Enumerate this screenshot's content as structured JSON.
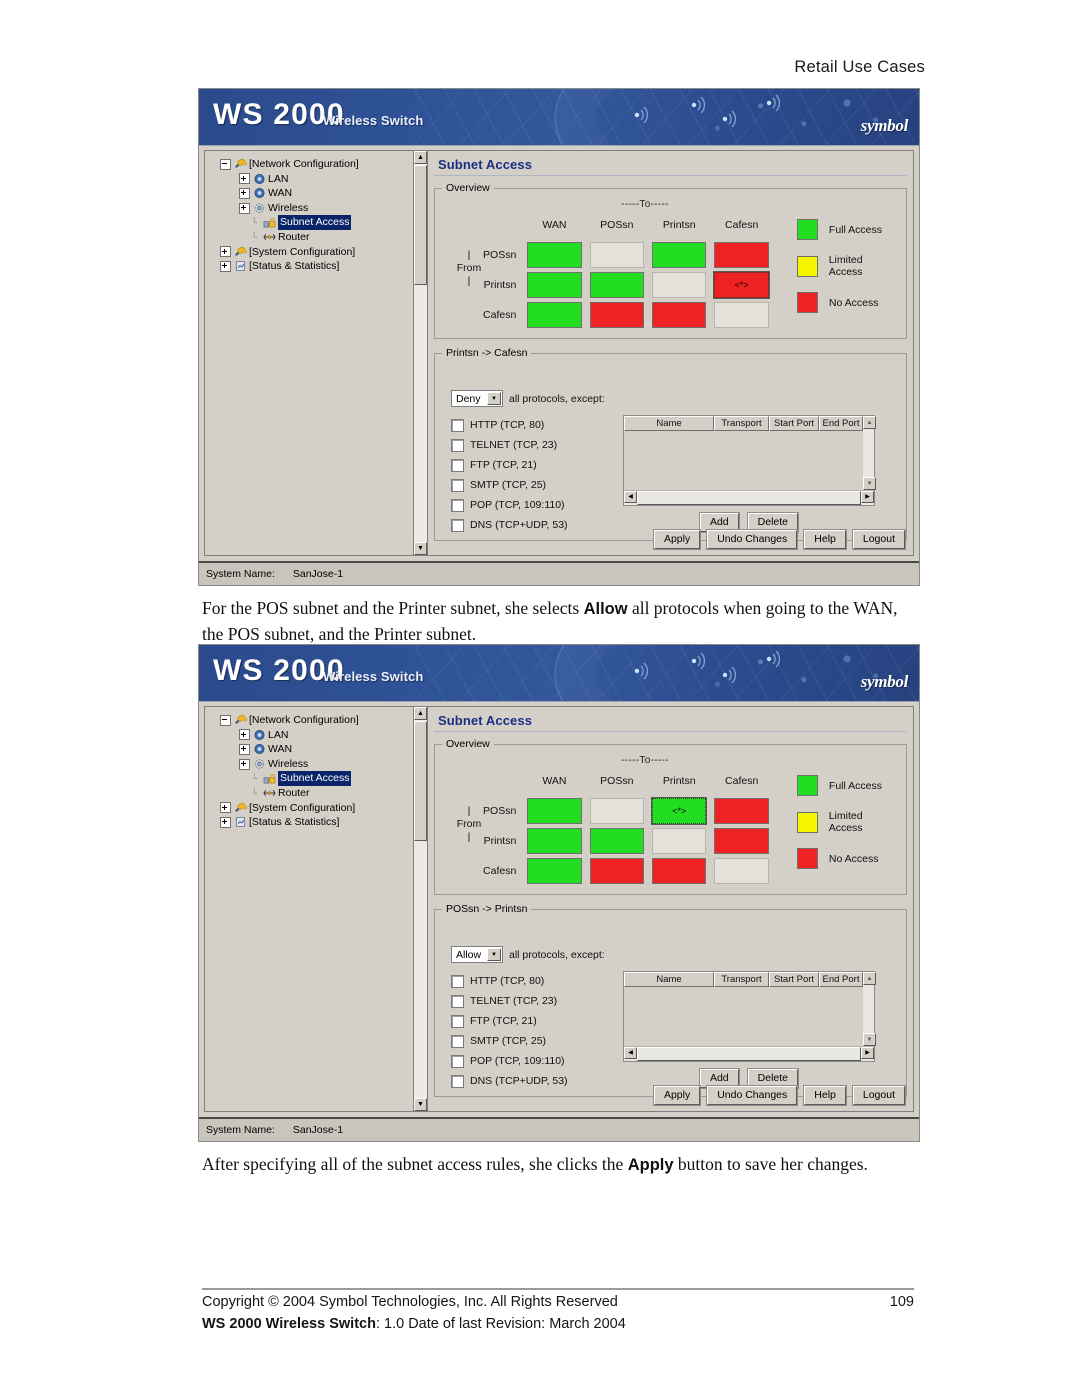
{
  "page": {
    "running_header": "Retail Use Cases",
    "page_number": "109"
  },
  "paragraphs": {
    "first_part1": "For the POS subnet and the Printer subnet, she selects ",
    "first_bold": "Allow",
    "first_part2": " all protocols when going to the WAN, the POS subnet, and the Printer subnet.",
    "second_part1": "After specifying all of the subnet access rules, she clicks the ",
    "second_bold": "Apply",
    "second_part2": " button to save her changes."
  },
  "footer": {
    "copyright": "Copyright © 2004 Symbol Technologies, Inc. All Rights Reserved",
    "product_bold": "WS 2000 Wireless Switch",
    "product_rest": ": 1.0  Date of last Revision: March 2004"
  },
  "app": {
    "banner": {
      "title": "WS 2000",
      "subtitle": "Wireless Switch",
      "logo": "symbol"
    },
    "tree": [
      {
        "label": "[Network Configuration]",
        "indent": 0,
        "expander": "minus",
        "icon": "wrench-network-icon",
        "selected": false
      },
      {
        "label": "LAN",
        "indent": 1,
        "expander": "plus",
        "icon": "lan-icon",
        "selected": false
      },
      {
        "label": "WAN",
        "indent": 1,
        "expander": "plus",
        "icon": "wan-icon",
        "selected": false
      },
      {
        "label": "Wireless",
        "indent": 1,
        "expander": "plus",
        "icon": "wireless-icon",
        "selected": false
      },
      {
        "label": "Subnet Access",
        "indent": 2,
        "expander": "none",
        "icon": "subnet-access-icon",
        "selected": true
      },
      {
        "label": "Router",
        "indent": 2,
        "expander": "none",
        "icon": "router-icon",
        "selected": false
      },
      {
        "label": "[System Configuration]",
        "indent": 0,
        "expander": "plus",
        "icon": "wrench-system-icon",
        "selected": false
      },
      {
        "label": "[Status & Statistics]",
        "indent": 0,
        "expander": "plus",
        "icon": "status-icon",
        "selected": false
      }
    ],
    "content_title": "Subnet Access",
    "overview": {
      "legend_title": "Overview",
      "to_label": "-----To-----",
      "from_label": "| From |",
      "columns": [
        "WAN",
        "POSsn",
        "Printsn",
        "Cafesn"
      ],
      "rows": [
        "POSsn",
        "Printsn",
        "Cafesn"
      ],
      "selected_marker": "<*>",
      "legend": [
        {
          "label": "Full Access",
          "color": "#22dd22",
          "state": "full"
        },
        {
          "label": "Limited Access",
          "color": "#f5f500",
          "state": "limited"
        },
        {
          "label": "No Access",
          "color": "#ee2222",
          "state": "none"
        }
      ]
    },
    "rules": {
      "all_protocols_label": "all protocols, except:",
      "protocols": [
        "HTTP (TCP, 80)",
        "TELNET (TCP, 23)",
        "FTP (TCP, 21)",
        "SMTP (TCP, 25)",
        "POP (TCP, 109:110)",
        "DNS (TCP+UDP, 53)"
      ],
      "grid_columns": [
        "Name",
        "Transport",
        "Start Port",
        "End Port"
      ],
      "grid_rows": [],
      "add_label": "Add",
      "delete_label": "Delete"
    },
    "actions": [
      "Apply",
      "Undo Changes",
      "Help",
      "Logout"
    ],
    "statusbar": {
      "label": "System Name:",
      "value": "SanJose-1"
    }
  },
  "screenshot1": {
    "rules_legend": "Printsn -> Cafesn",
    "policy_value": "Deny",
    "matrix": [
      [
        "full",
        "blank",
        "full",
        "none"
      ],
      [
        "full",
        "full",
        "blank",
        "none-selected"
      ],
      [
        "full",
        "none",
        "none",
        "blank"
      ]
    ]
  },
  "screenshot2": {
    "rules_legend": "POSsn -> Printsn",
    "policy_value": "Allow",
    "matrix": [
      [
        "full",
        "blank",
        "full-selected",
        "none"
      ],
      [
        "full",
        "full",
        "blank",
        "none"
      ],
      [
        "full",
        "none",
        "none",
        "blank"
      ]
    ]
  }
}
